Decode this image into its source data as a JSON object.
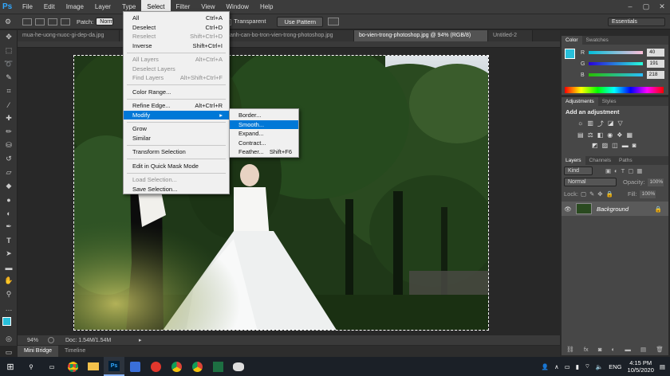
{
  "app": {
    "logo": "Ps"
  },
  "menubar": {
    "items": [
      "File",
      "Edit",
      "Image",
      "Layer",
      "Type",
      "Select",
      "Filter",
      "View",
      "Window",
      "Help"
    ],
    "active": "Select"
  },
  "window_controls": [
    "–",
    "▢",
    "✕"
  ],
  "options": {
    "patch_label": "Patch:",
    "patch_value": "Normal",
    "transparent_label": "Transparent",
    "use_pattern": "Use Pattern",
    "workspace": "Essentials"
  },
  "tabs": [
    {
      "label": "mua-he-uong-nuoc-gi-dep-da.jpg",
      "active": false
    },
    {
      "label": "...",
      "active": false
    },
    {
      "label": "anh-can-bo-tron-vien-trong-photoshop.jpg",
      "active": false
    },
    {
      "label": "bo-vien-trong-photoshop.jpg @ 94% (RGB/8)",
      "active": true
    },
    {
      "label": "Untitled-2",
      "active": false
    }
  ],
  "select_menu": {
    "items": [
      {
        "label": "All",
        "shortcut": "Ctrl+A",
        "state": "normal"
      },
      {
        "label": "Deselect",
        "shortcut": "Ctrl+D",
        "state": "normal"
      },
      {
        "label": "Reselect",
        "shortcut": "Shift+Ctrl+D",
        "state": "disabled"
      },
      {
        "label": "Inverse",
        "shortcut": "Shift+Ctrl+I",
        "state": "normal"
      },
      {
        "sep": true
      },
      {
        "label": "All Layers",
        "shortcut": "Alt+Ctrl+A",
        "state": "disabled"
      },
      {
        "label": "Deselect Layers",
        "shortcut": "",
        "state": "disabled"
      },
      {
        "label": "Find Layers",
        "shortcut": "Alt+Shift+Ctrl+F",
        "state": "disabled"
      },
      {
        "sep": true
      },
      {
        "label": "Color Range...",
        "shortcut": "",
        "state": "normal"
      },
      {
        "sep": true
      },
      {
        "label": "Refine Edge...",
        "shortcut": "Alt+Ctrl+R",
        "state": "normal"
      },
      {
        "label": "Modify",
        "shortcut": "",
        "state": "highlighted",
        "submenu": true
      },
      {
        "sep": true
      },
      {
        "label": "Grow",
        "shortcut": "",
        "state": "normal"
      },
      {
        "label": "Similar",
        "shortcut": "",
        "state": "normal"
      },
      {
        "sep": true
      },
      {
        "label": "Transform Selection",
        "shortcut": "",
        "state": "normal"
      },
      {
        "sep": true
      },
      {
        "label": "Edit in Quick Mask Mode",
        "shortcut": "",
        "state": "normal"
      },
      {
        "sep": true
      },
      {
        "label": "Load Selection...",
        "shortcut": "",
        "state": "disabled"
      },
      {
        "label": "Save Selection...",
        "shortcut": "",
        "state": "normal"
      }
    ]
  },
  "modify_submenu": {
    "items": [
      {
        "label": "Border...",
        "shortcut": "",
        "state": "normal"
      },
      {
        "label": "Smooth...",
        "shortcut": "",
        "state": "highlighted"
      },
      {
        "label": "Expand...",
        "shortcut": "",
        "state": "normal"
      },
      {
        "label": "Contract...",
        "shortcut": "",
        "state": "normal"
      },
      {
        "label": "Feather...",
        "shortcut": "Shift+F6",
        "state": "normal"
      }
    ]
  },
  "status": {
    "zoom": "94%",
    "doc": "Doc: 1.54M/1.54M"
  },
  "bottom_tabs": [
    "Mini Bridge",
    "Timeline"
  ],
  "color_panel": {
    "tabs": [
      "Color",
      "Swatches"
    ],
    "r_label": "R",
    "g_label": "G",
    "b_label": "B",
    "r": "40",
    "g": "191",
    "b": "218",
    "fg_color": "#28bfda"
  },
  "adjustments_panel": {
    "tabs": [
      "Adjustments",
      "Styles"
    ],
    "title": "Add an adjustment"
  },
  "layers_panel": {
    "tabs": [
      "Layers",
      "Channels",
      "Paths"
    ],
    "kind": "Kind",
    "blend": "Normal",
    "opacity_label": "Opacity:",
    "opacity": "100%",
    "lock_label": "Lock:",
    "fill_label": "Fill:",
    "fill": "100%",
    "layer_name": "Background"
  },
  "taskbar": {
    "time": "4:15 PM",
    "date": "10/5/2020",
    "lang": "ENG"
  }
}
